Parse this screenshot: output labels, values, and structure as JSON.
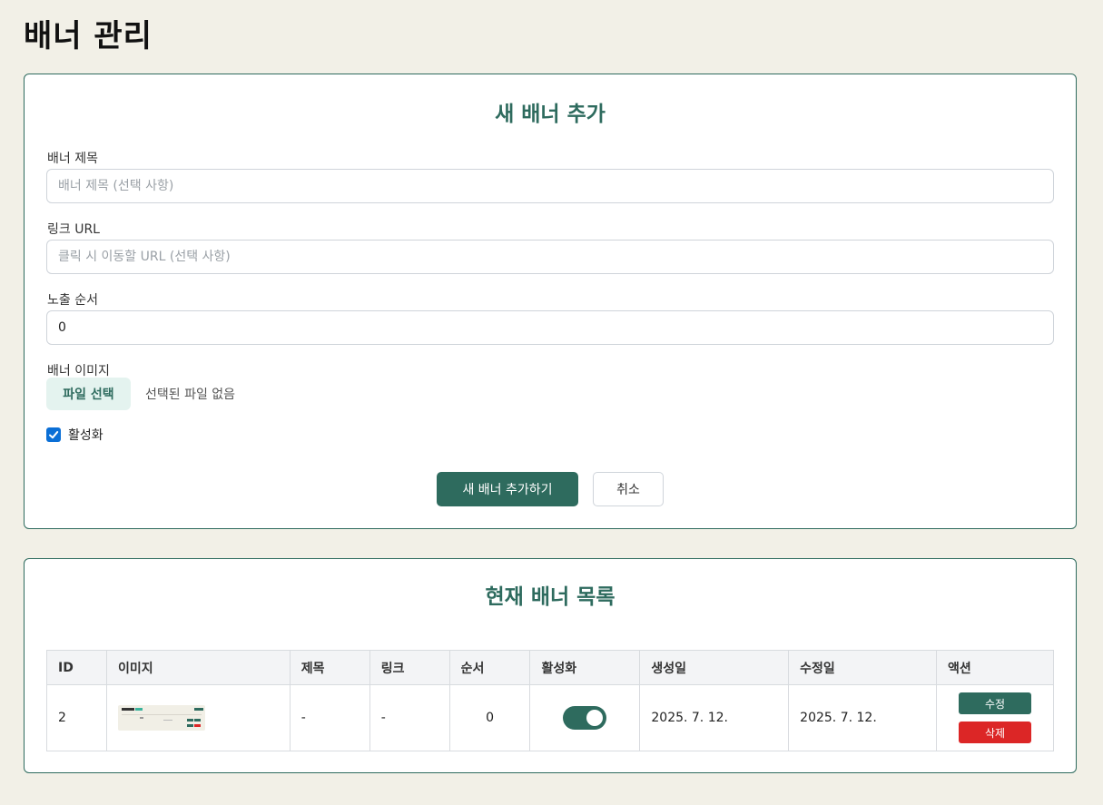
{
  "page": {
    "title": "배너 관리"
  },
  "form": {
    "heading": "새 배너 추가",
    "title_label": "배너 제목",
    "title_placeholder": "배너 제목 (선택 사항)",
    "link_label": "링크 URL",
    "link_placeholder": "클릭 시 이동할 URL (선택 사항)",
    "order_label": "노출 순서",
    "order_value": "0",
    "image_label": "배너 이미지",
    "file_button": "파일 선택",
    "file_status": "선택된 파일 없음",
    "active_label": "활성화",
    "active_checked": true,
    "submit_button": "새 배너 추가하기",
    "cancel_button": "취소"
  },
  "list": {
    "heading": "현재 배너 목록",
    "columns": [
      "ID",
      "이미지",
      "제목",
      "링크",
      "순서",
      "활성화",
      "생성일",
      "수정일",
      "액션"
    ],
    "rows": [
      {
        "id": "2",
        "title": "-",
        "link": "-",
        "order": "0",
        "active": true,
        "created": "2025. 7. 12.",
        "updated": "2025. 7. 12.",
        "edit_button": "수정",
        "delete_button": "삭제"
      }
    ]
  },
  "colors": {
    "accent": "#2e6b5e",
    "danger": "#dc2626",
    "background": "#f2f0e7",
    "checkbox": "#0b6fd6"
  }
}
